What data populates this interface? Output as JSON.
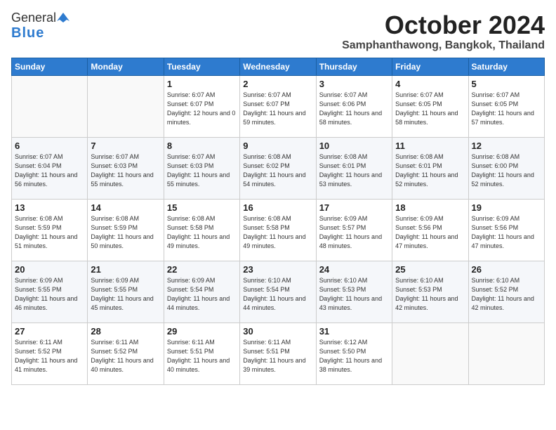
{
  "header": {
    "logo_general": "General",
    "logo_blue": "Blue",
    "month": "October 2024",
    "location": "Samphanthawong, Bangkok, Thailand"
  },
  "weekdays": [
    "Sunday",
    "Monday",
    "Tuesday",
    "Wednesday",
    "Thursday",
    "Friday",
    "Saturday"
  ],
  "weeks": [
    [
      {
        "day": "",
        "sunrise": "",
        "sunset": "",
        "daylight": ""
      },
      {
        "day": "",
        "sunrise": "",
        "sunset": "",
        "daylight": ""
      },
      {
        "day": "1",
        "sunrise": "Sunrise: 6:07 AM",
        "sunset": "Sunset: 6:07 PM",
        "daylight": "Daylight: 12 hours and 0 minutes."
      },
      {
        "day": "2",
        "sunrise": "Sunrise: 6:07 AM",
        "sunset": "Sunset: 6:07 PM",
        "daylight": "Daylight: 11 hours and 59 minutes."
      },
      {
        "day": "3",
        "sunrise": "Sunrise: 6:07 AM",
        "sunset": "Sunset: 6:06 PM",
        "daylight": "Daylight: 11 hours and 58 minutes."
      },
      {
        "day": "4",
        "sunrise": "Sunrise: 6:07 AM",
        "sunset": "Sunset: 6:05 PM",
        "daylight": "Daylight: 11 hours and 58 minutes."
      },
      {
        "day": "5",
        "sunrise": "Sunrise: 6:07 AM",
        "sunset": "Sunset: 6:05 PM",
        "daylight": "Daylight: 11 hours and 57 minutes."
      }
    ],
    [
      {
        "day": "6",
        "sunrise": "Sunrise: 6:07 AM",
        "sunset": "Sunset: 6:04 PM",
        "daylight": "Daylight: 11 hours and 56 minutes."
      },
      {
        "day": "7",
        "sunrise": "Sunrise: 6:07 AM",
        "sunset": "Sunset: 6:03 PM",
        "daylight": "Daylight: 11 hours and 55 minutes."
      },
      {
        "day": "8",
        "sunrise": "Sunrise: 6:07 AM",
        "sunset": "Sunset: 6:03 PM",
        "daylight": "Daylight: 11 hours and 55 minutes."
      },
      {
        "day": "9",
        "sunrise": "Sunrise: 6:08 AM",
        "sunset": "Sunset: 6:02 PM",
        "daylight": "Daylight: 11 hours and 54 minutes."
      },
      {
        "day": "10",
        "sunrise": "Sunrise: 6:08 AM",
        "sunset": "Sunset: 6:01 PM",
        "daylight": "Daylight: 11 hours and 53 minutes."
      },
      {
        "day": "11",
        "sunrise": "Sunrise: 6:08 AM",
        "sunset": "Sunset: 6:01 PM",
        "daylight": "Daylight: 11 hours and 52 minutes."
      },
      {
        "day": "12",
        "sunrise": "Sunrise: 6:08 AM",
        "sunset": "Sunset: 6:00 PM",
        "daylight": "Daylight: 11 hours and 52 minutes."
      }
    ],
    [
      {
        "day": "13",
        "sunrise": "Sunrise: 6:08 AM",
        "sunset": "Sunset: 5:59 PM",
        "daylight": "Daylight: 11 hours and 51 minutes."
      },
      {
        "day": "14",
        "sunrise": "Sunrise: 6:08 AM",
        "sunset": "Sunset: 5:59 PM",
        "daylight": "Daylight: 11 hours and 50 minutes."
      },
      {
        "day": "15",
        "sunrise": "Sunrise: 6:08 AM",
        "sunset": "Sunset: 5:58 PM",
        "daylight": "Daylight: 11 hours and 49 minutes."
      },
      {
        "day": "16",
        "sunrise": "Sunrise: 6:08 AM",
        "sunset": "Sunset: 5:58 PM",
        "daylight": "Daylight: 11 hours and 49 minutes."
      },
      {
        "day": "17",
        "sunrise": "Sunrise: 6:09 AM",
        "sunset": "Sunset: 5:57 PM",
        "daylight": "Daylight: 11 hours and 48 minutes."
      },
      {
        "day": "18",
        "sunrise": "Sunrise: 6:09 AM",
        "sunset": "Sunset: 5:56 PM",
        "daylight": "Daylight: 11 hours and 47 minutes."
      },
      {
        "day": "19",
        "sunrise": "Sunrise: 6:09 AM",
        "sunset": "Sunset: 5:56 PM",
        "daylight": "Daylight: 11 hours and 47 minutes."
      }
    ],
    [
      {
        "day": "20",
        "sunrise": "Sunrise: 6:09 AM",
        "sunset": "Sunset: 5:55 PM",
        "daylight": "Daylight: 11 hours and 46 minutes."
      },
      {
        "day": "21",
        "sunrise": "Sunrise: 6:09 AM",
        "sunset": "Sunset: 5:55 PM",
        "daylight": "Daylight: 11 hours and 45 minutes."
      },
      {
        "day": "22",
        "sunrise": "Sunrise: 6:09 AM",
        "sunset": "Sunset: 5:54 PM",
        "daylight": "Daylight: 11 hours and 44 minutes."
      },
      {
        "day": "23",
        "sunrise": "Sunrise: 6:10 AM",
        "sunset": "Sunset: 5:54 PM",
        "daylight": "Daylight: 11 hours and 44 minutes."
      },
      {
        "day": "24",
        "sunrise": "Sunrise: 6:10 AM",
        "sunset": "Sunset: 5:53 PM",
        "daylight": "Daylight: 11 hours and 43 minutes."
      },
      {
        "day": "25",
        "sunrise": "Sunrise: 6:10 AM",
        "sunset": "Sunset: 5:53 PM",
        "daylight": "Daylight: 11 hours and 42 minutes."
      },
      {
        "day": "26",
        "sunrise": "Sunrise: 6:10 AM",
        "sunset": "Sunset: 5:52 PM",
        "daylight": "Daylight: 11 hours and 42 minutes."
      }
    ],
    [
      {
        "day": "27",
        "sunrise": "Sunrise: 6:11 AM",
        "sunset": "Sunset: 5:52 PM",
        "daylight": "Daylight: 11 hours and 41 minutes."
      },
      {
        "day": "28",
        "sunrise": "Sunrise: 6:11 AM",
        "sunset": "Sunset: 5:52 PM",
        "daylight": "Daylight: 11 hours and 40 minutes."
      },
      {
        "day": "29",
        "sunrise": "Sunrise: 6:11 AM",
        "sunset": "Sunset: 5:51 PM",
        "daylight": "Daylight: 11 hours and 40 minutes."
      },
      {
        "day": "30",
        "sunrise": "Sunrise: 6:11 AM",
        "sunset": "Sunset: 5:51 PM",
        "daylight": "Daylight: 11 hours and 39 minutes."
      },
      {
        "day": "31",
        "sunrise": "Sunrise: 6:12 AM",
        "sunset": "Sunset: 5:50 PM",
        "daylight": "Daylight: 11 hours and 38 minutes."
      },
      {
        "day": "",
        "sunrise": "",
        "sunset": "",
        "daylight": ""
      },
      {
        "day": "",
        "sunrise": "",
        "sunset": "",
        "daylight": ""
      }
    ]
  ]
}
